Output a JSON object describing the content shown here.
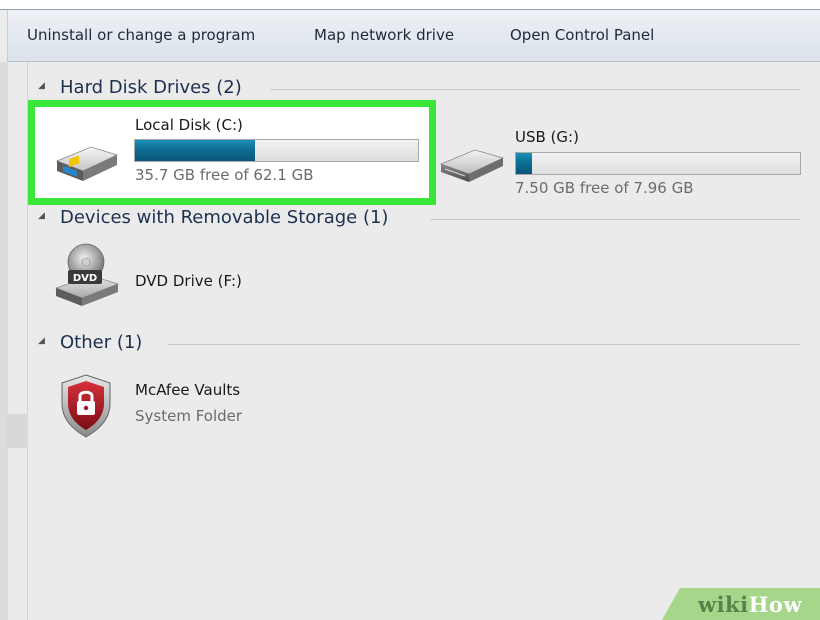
{
  "toolbar": {
    "buttons": [
      {
        "label": "Uninstall or change a program"
      },
      {
        "label": "Map network drive"
      },
      {
        "label": "Open Control Panel"
      }
    ]
  },
  "groups": {
    "hard_disks": {
      "title": "Hard Disk Drives (2)",
      "drives": [
        {
          "name": "Local Disk (C:)",
          "free_text": "35.7 GB free of 62.1 GB",
          "used_fraction": 0.425,
          "icon": "hard-drive-icon",
          "highlighted": true
        },
        {
          "name": "USB (G:)",
          "free_text": "7.50 GB free of 7.96 GB",
          "used_fraction": 0.058,
          "icon": "usb-drive-icon",
          "highlighted": false
        }
      ]
    },
    "removable": {
      "title": "Devices with Removable Storage (1)",
      "items": [
        {
          "name": "DVD Drive (F:)",
          "icon": "dvd-drive-icon",
          "icon_label": "DVD"
        }
      ]
    },
    "other": {
      "title": "Other (1)",
      "items": [
        {
          "name": "McAfee Vaults",
          "subtitle": "System Folder",
          "icon": "shield-lock-icon"
        }
      ]
    }
  },
  "highlight_color": "#39e639",
  "capacity_bar_color": "#0f6e93",
  "watermark": {
    "prefix": "wiki",
    "suffix": "How"
  }
}
